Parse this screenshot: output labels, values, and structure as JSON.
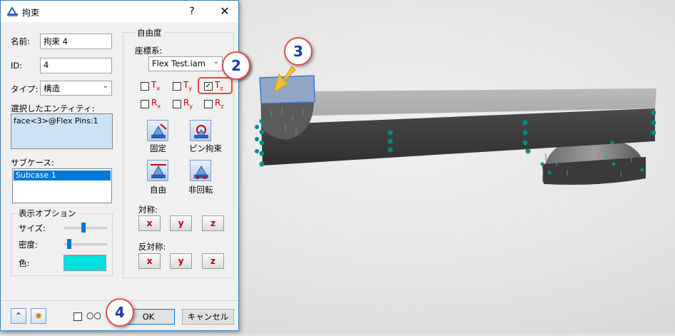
{
  "dialog": {
    "title": "拘束",
    "help_label": "?",
    "close_label": "✕",
    "name_label": "名前:",
    "name_value": "拘束 4",
    "id_label": "ID:",
    "id_value": "4",
    "type_label": "タイプ:",
    "type_value": "構造",
    "entities_label": "選択したエンティティ:",
    "entities_items": [
      "face<3>@Flex Pins:1"
    ],
    "subcase_label": "サブケース:",
    "subcase_items": [
      "Subcase 1"
    ],
    "display_options": {
      "title": "表示オプション",
      "size_label": "サイズ:",
      "size_level": 0.45,
      "density_label": "密度:",
      "density_level": 0.08,
      "color_label": "色:",
      "color": "#00e0e0"
    },
    "dof": {
      "title": "自由度",
      "coord_label": "座標系:",
      "coord_value": "Flex Test.iam",
      "translations": [
        {
          "symbol": "T",
          "axis": "x",
          "checked": false
        },
        {
          "symbol": "T",
          "axis": "y",
          "checked": false
        },
        {
          "symbol": "T",
          "axis": "z",
          "checked": true
        }
      ],
      "rotations": [
        {
          "symbol": "R",
          "axis": "x",
          "checked": false
        },
        {
          "symbol": "R",
          "axis": "y",
          "checked": false
        },
        {
          "symbol": "R",
          "axis": "z",
          "checked": false
        }
      ],
      "tools": [
        {
          "label": "固定",
          "icon": "fixed-constraint-icon"
        },
        {
          "label": "ピン拘束",
          "icon": "pin-constraint-icon"
        },
        {
          "label": "自由",
          "icon": "free-constraint-icon"
        },
        {
          "label": "非回転",
          "icon": "no-rotation-constraint-icon"
        }
      ],
      "symmetry_label": "対称:",
      "symmetry_buttons": [
        "x",
        "y",
        "z"
      ],
      "antisymmetry_label": "反対称:",
      "antisymmetry_buttons": [
        "x",
        "y",
        "z"
      ]
    },
    "footer": {
      "ok_label": "OK",
      "cancel_label": "キャンセル",
      "glasses_icon": "glasses-icon",
      "expand_icon": "chevron-double-up-icon",
      "highlight_icon": "sunburst-icon"
    }
  },
  "callouts": [
    "2",
    "3",
    "4"
  ],
  "colors": {
    "accent": "#0078d7",
    "callout_border": "#d9534f",
    "callout_text": "#1a3ca6",
    "dof_red": "#c00000",
    "constraint_marker": "#008b8b"
  }
}
